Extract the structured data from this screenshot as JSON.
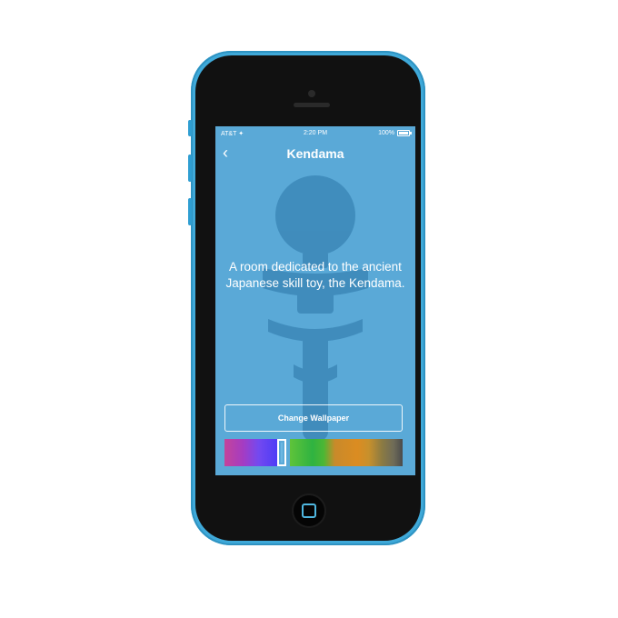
{
  "status_bar": {
    "carrier": "AT&T ✦",
    "time": "2:20 PM",
    "battery": "100%"
  },
  "nav": {
    "back_icon": "chevron-left-icon",
    "title": "Kendama"
  },
  "content": {
    "description": "A room dedicated to the ancient Japanese skill toy, the Kendama."
  },
  "actions": {
    "change_wallpaper_label": "Change Wallpaper"
  },
  "wallpaper_swatches": {
    "selected_index": 1,
    "colors": [
      "#c4449a",
      "#7349f0",
      "#6cb8e2",
      "#2fb341",
      "#db8c21",
      "#4b4b4b"
    ]
  },
  "theme": {
    "screen_bg": "#5aa9d7",
    "phone_body": "#3fa9d9",
    "silhouette": "#3c88b8"
  }
}
